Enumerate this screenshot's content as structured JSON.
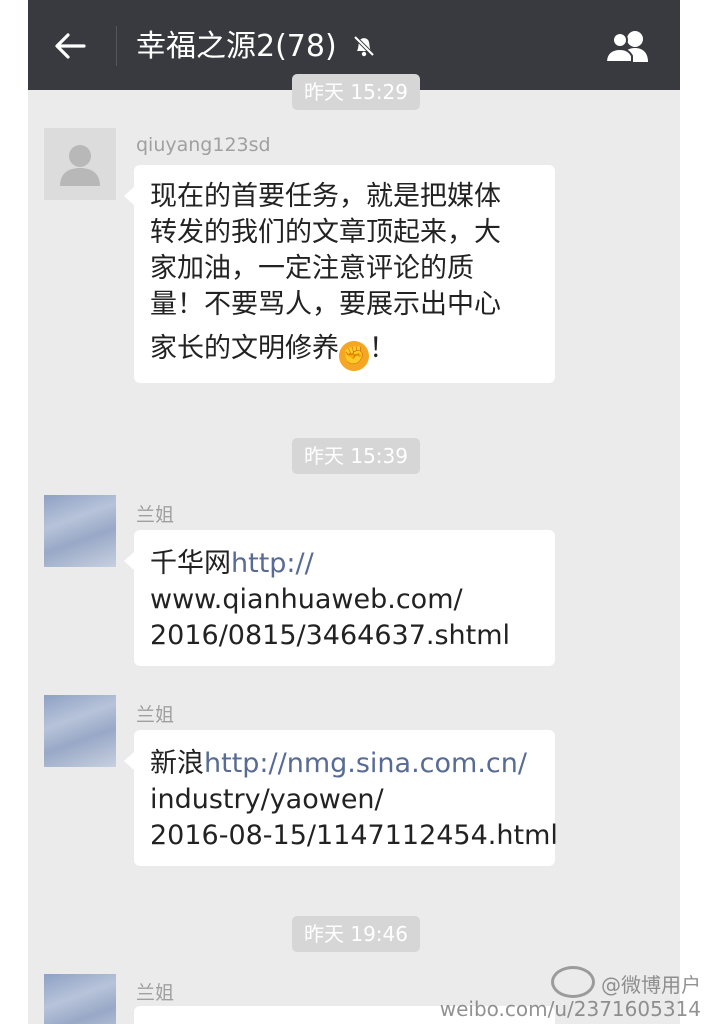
{
  "header": {
    "back_icon": "arrow-left-icon",
    "title": "幸福之源2(78)",
    "mute_icon": "bell-off-icon",
    "group_icon": "people-icon"
  },
  "timestamps": [
    {
      "label": "昨天 15:29"
    },
    {
      "label": "昨天 15:39"
    },
    {
      "label": "昨天 19:46"
    }
  ],
  "messages": [
    {
      "sender": "qiuyang123sd",
      "lines": [
        "现在的首要任务，就是把媒体",
        "转发的我们的文章顶起来，大",
        "家加油，一定注意评论的质",
        "量！不要骂人，要展示出中心"
      ],
      "last_line_before": "家长的文明修养",
      "emoji": "fist-emoji",
      "last_line_after": "！"
    },
    {
      "sender": "兰姐",
      "prefix": "千华网",
      "link_lines": [
        "http://",
        "www.qianhuaweb.com/",
        "2016/0815/3464637.shtml"
      ]
    },
    {
      "sender": "兰姐",
      "prefix": "新浪",
      "link_lines": [
        "http://nmg.sina.com.cn/",
        "industry/yaowen/",
        "2016-08-15/1147112454.html"
      ]
    },
    {
      "sender": "兰姐"
    }
  ],
  "watermark": {
    "line1": "@微博用户",
    "line2": "weibo.com/u/2371605314"
  },
  "colors": {
    "topbar": "#393a3f",
    "chat_bg": "#ebebeb",
    "link": "#576b95"
  }
}
